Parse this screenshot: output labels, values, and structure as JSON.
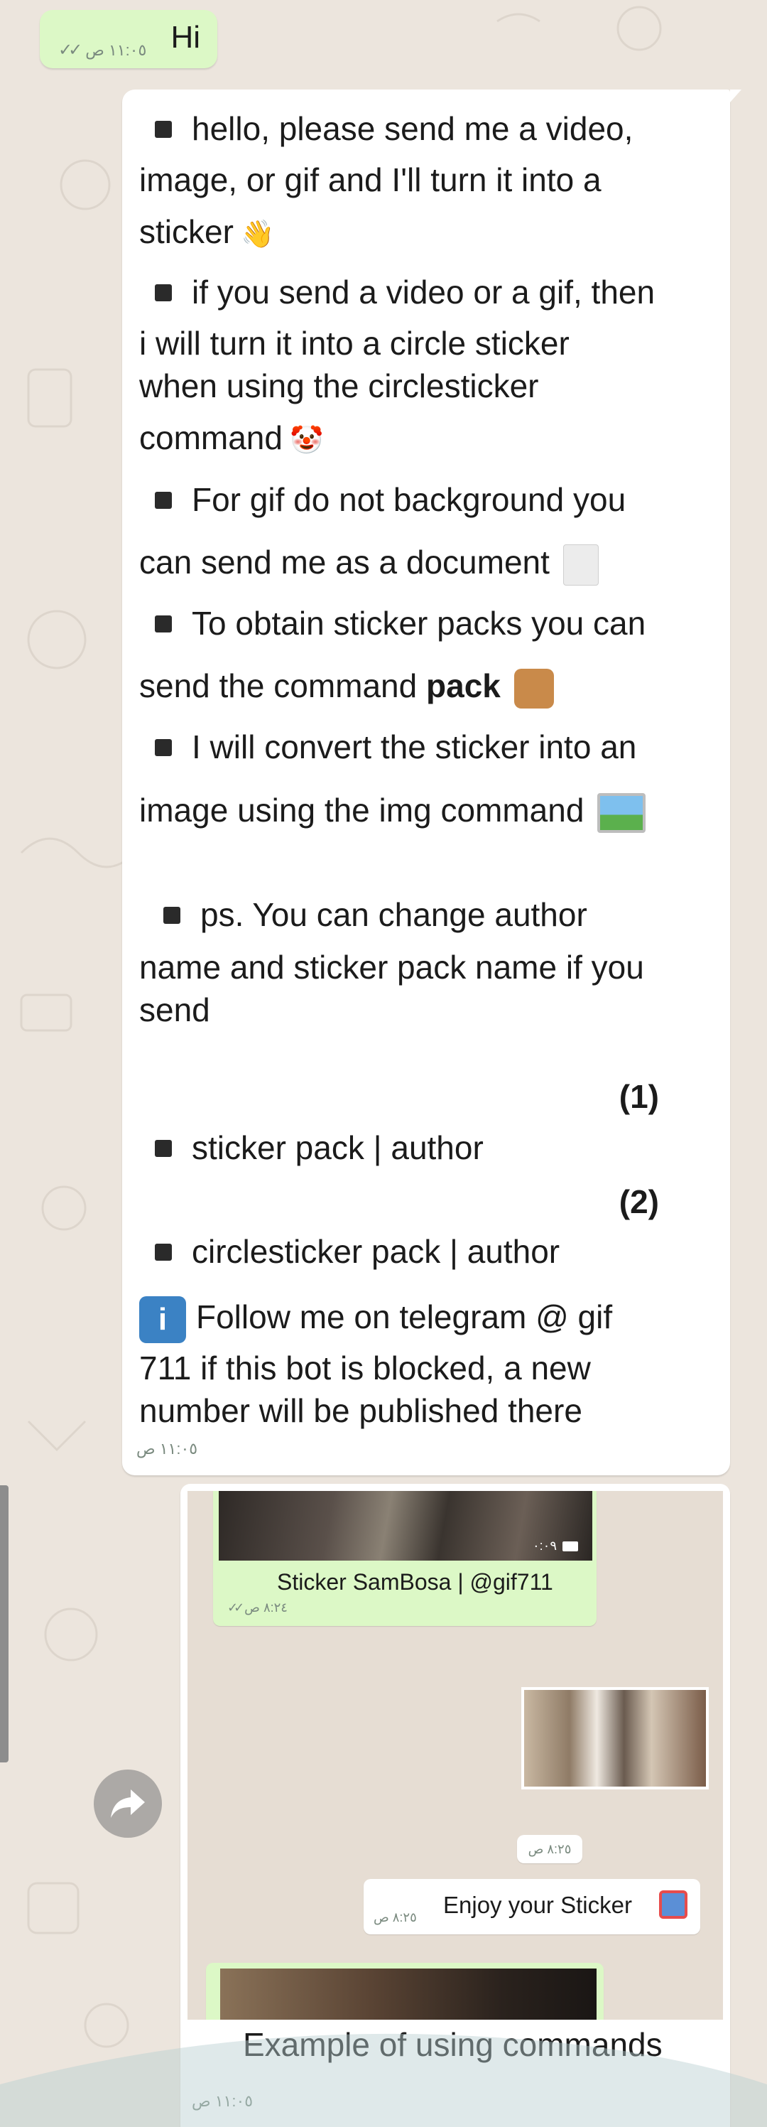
{
  "messages": {
    "hi": {
      "text": "Hi",
      "time": "١١:٠٥ ص"
    },
    "bot": {
      "lines": [
        "hello, please send me a video,",
        "image, or gif and I'll turn it into a",
        "sticker",
        "if you send a video or a gif, then",
        "i will turn it into a circle sticker",
        "when using the circlesticker",
        "command",
        "For  gif do not background you",
        "can send me as a document",
        "To obtain sticker packs you can",
        "send the command",
        "pack",
        "I will convert the sticker into an",
        "image using the img command",
        "ps. You can change author",
        "name and sticker pack name if you",
        "send",
        "(1)",
        "sticker pack | author",
        "(2)",
        "circlesticker pack | author",
        "Follow me on telegram @ gif",
        "711 if this bot is blocked, a new",
        "number will be published there"
      ],
      "time": "١١:٠٥ ص"
    },
    "screenshot": {
      "video_duration": "٠:٠٩",
      "sticker_caption": "Sticker SamBosa | @gif711",
      "sticker_time": "٨:٢٤ ص",
      "photo_time": "٨:٢٥ ص",
      "enjoy_text": "Enjoy your Sticker",
      "enjoy_time": "٨:٢٥ ص",
      "caption": "Example of using commands",
      "time": "١١:٠٥ ص"
    }
  },
  "icons": {
    "wave": "waving-hand-icon",
    "clown": "clown-face-icon",
    "doc": "document-icon",
    "package": "package-icon",
    "picture": "framed-picture-icon",
    "info": "info-icon",
    "gift": "gift-icon",
    "forward": "forward-arrow-icon",
    "read": "double-check-icon"
  },
  "colors": {
    "outgoing": "#dcf8c6",
    "incoming": "#ffffff",
    "wallpaper": "#ece5dd"
  }
}
